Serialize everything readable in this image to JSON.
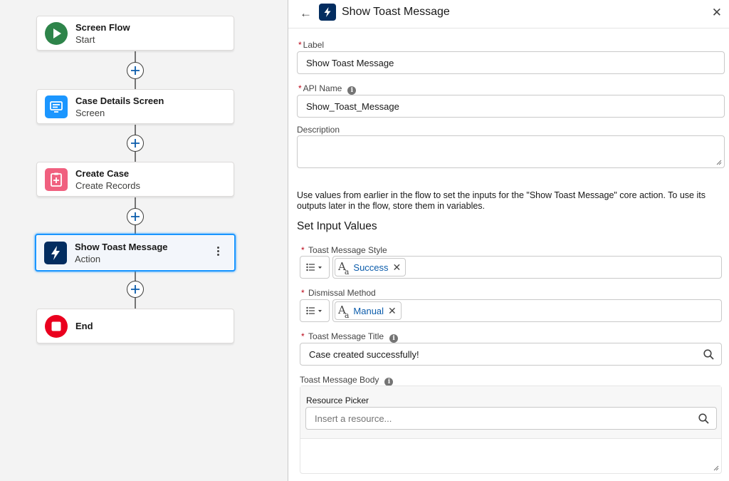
{
  "canvas": {
    "nodes": [
      {
        "title": "Screen Flow",
        "subtitle": "Start",
        "icon": "play-icon",
        "color": "#3ba755"
      },
      {
        "title": "Case Details Screen",
        "subtitle": "Screen",
        "icon": "screen-icon",
        "color": "#1b96ff"
      },
      {
        "title": "Create Case",
        "subtitle": "Create Records",
        "icon": "create-record-icon",
        "color": "#f0607f"
      },
      {
        "title": "Show Toast Message",
        "subtitle": "Action",
        "icon": "lightning-icon",
        "color": "#032d60"
      },
      {
        "title": "End",
        "subtitle": "",
        "icon": "stop-icon",
        "color": "#ea001e"
      }
    ]
  },
  "panel": {
    "title": "Show Toast Message",
    "label_field": {
      "label": "Label",
      "value": "Show Toast Message"
    },
    "api_field": {
      "label": "API Name",
      "value": "Show_Toast_Message"
    },
    "description_field": {
      "label": "Description",
      "value": ""
    },
    "help_text": "Use values from earlier in the flow to set the inputs for the \"Show Toast Message\" core action. To use its outputs later in the flow, store them in variables.",
    "section_title": "Set Input Values",
    "style_field": {
      "label": "Toast Message Style",
      "value": "Success"
    },
    "dismissal_field": {
      "label": "Dismissal Method",
      "value": "Manual"
    },
    "title_field": {
      "label": "Toast Message Title",
      "value": "Case created successfully!"
    },
    "body_field": {
      "label": "Toast Message Body",
      "picker_label": "Resource Picker",
      "placeholder": "Insert a resource..."
    }
  },
  "colors": {
    "accent": "#1b96ff",
    "link": "#0b5cab",
    "required": "#ba0517"
  }
}
